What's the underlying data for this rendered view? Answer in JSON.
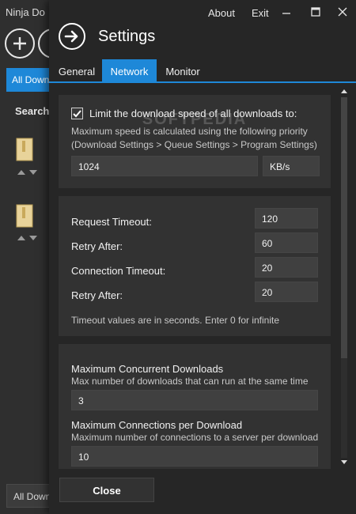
{
  "background_app": {
    "title": "Ninja Do",
    "tab_label": "All Down",
    "search_label": "Search",
    "bottom_label": "All Down"
  },
  "window": {
    "about_label": "About",
    "exit_label": "Exit"
  },
  "settings": {
    "title": "Settings",
    "tabs": [
      {
        "label": "General",
        "active": false
      },
      {
        "label": "Network",
        "active": true
      },
      {
        "label": "Monitor",
        "active": false
      }
    ],
    "watermark": "SOFTPEDIA",
    "speed_limit": {
      "checkbox_label": "Limit the download speed of all downloads to:",
      "checked": true,
      "description_line1": "Maximum speed is calculated using the following priority",
      "description_line2": "(Download Settings > Queue Settings > Program Settings)",
      "value": "1024",
      "unit": "KB/s"
    },
    "timeouts": {
      "request_timeout_label": "Request Timeout:",
      "request_timeout_value": "120",
      "retry_after_label_1": "Retry After:",
      "retry_after_value_1": "60",
      "connection_timeout_label": "Connection Timeout:",
      "connection_timeout_value": "20",
      "retry_after_label_2": "Retry After:",
      "retry_after_value_2": "20",
      "note": "Timeout values are in seconds. Enter 0 for infinite"
    },
    "connections": {
      "max_concurrent_label": "Maximum Concurrent Downloads",
      "max_concurrent_desc": "Max number of downloads that can run at the same time",
      "max_concurrent_value": "3",
      "max_per_download_label": "Maximum Connections per Download",
      "max_per_download_desc": "Maximum number of connections to a server per download",
      "max_per_download_value": "10"
    },
    "close_label": "Close"
  },
  "colors": {
    "accent": "#1e88d8",
    "panel_bg": "#262626",
    "card_bg": "#323232",
    "field_bg": "#404040"
  }
}
